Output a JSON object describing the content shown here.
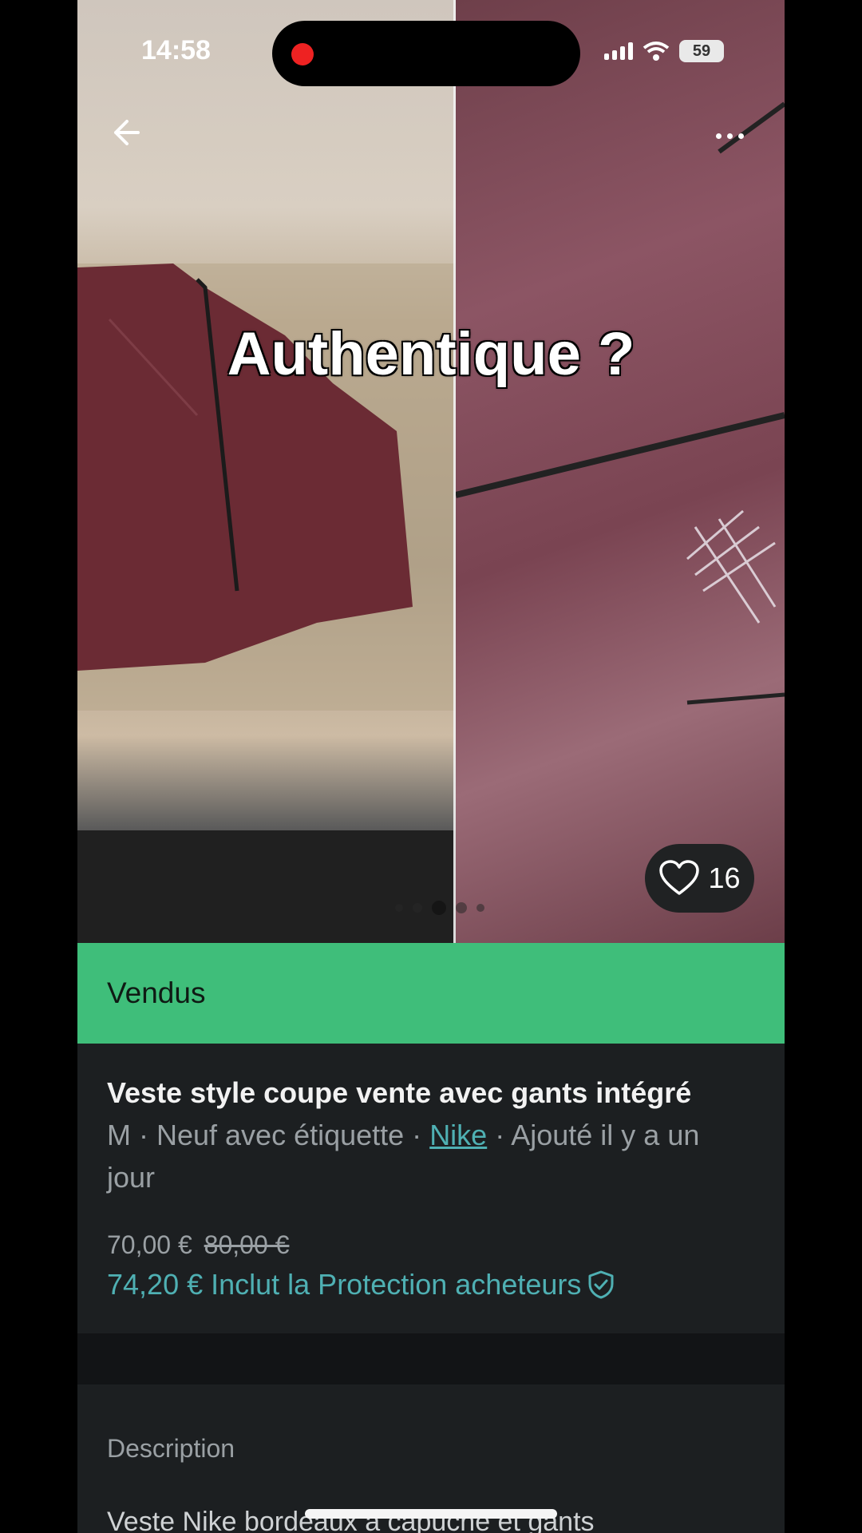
{
  "status_bar": {
    "time": "14:58",
    "battery": "59"
  },
  "photo": {
    "overlay_text": "Authentique ?",
    "likes": "16",
    "page_count": 5,
    "active_page": 2
  },
  "banner": {
    "label": "Vendus"
  },
  "item": {
    "title": "Veste style coupe vente avec gants intégré",
    "meta_prefix": "M · Neuf avec étiquette · ",
    "brand": "Nike",
    "meta_suffix": " · Ajouté il y a un jour",
    "price": "70,00 €",
    "old_price": "80,00 €",
    "price_with_protection": "74,20 € Inclut la Protection acheteurs"
  },
  "description": {
    "title": "Description",
    "text": "Veste Nike bordeaux à capuche et gants"
  },
  "colors": {
    "accent": "#4fb0b3",
    "sold_banner": "#3fbe7a",
    "background": "#1c1f21"
  },
  "icons": [
    "back-arrow-icon",
    "more-icon",
    "heart-icon",
    "shield-check-icon"
  ]
}
